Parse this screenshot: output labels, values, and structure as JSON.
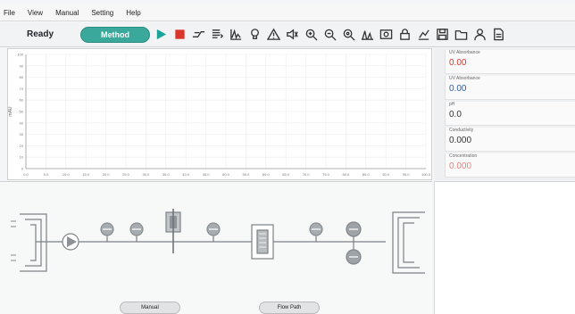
{
  "menu": [
    "File",
    "View",
    "Manual",
    "Setting",
    "Help"
  ],
  "toolbar": {
    "status": "Ready",
    "method_label": "Method",
    "icons": [
      "play-icon",
      "stop-icon",
      "gradient-icon",
      "list-icon",
      "peak-icon",
      "lamp-icon",
      "warning-icon",
      "speaker-icon",
      "zoom-in-icon",
      "zoom-out-icon",
      "zoom-reset-icon",
      "integrate-icon",
      "image-icon",
      "lock-icon",
      "chart-edit-icon",
      "save-icon",
      "folder-icon",
      "user-icon",
      "report-icon"
    ],
    "colors": {
      "play": "#1aa39a",
      "stop": "#d9352c",
      "icon": "#333333"
    }
  },
  "chart_data": {
    "type": "line",
    "xlabel": "",
    "ylabel": "mAU",
    "x_ticks": [
      "0.0",
      "5.0",
      "10.0",
      "15.0",
      "20.0",
      "25.0",
      "30.0",
      "35.0",
      "40.0",
      "45.0",
      "50.0",
      "55.0",
      "60.0",
      "65.0",
      "70.0",
      "75.0",
      "80.0",
      "85.0",
      "90.0",
      "95.0",
      "100.0"
    ],
    "y_ticks": [
      "100",
      "90",
      "80",
      "70",
      "60",
      "50",
      "40",
      "30",
      "20",
      "10",
      "0"
    ],
    "xlim": [
      0,
      100
    ],
    "ylim": [
      0,
      100
    ],
    "series": [],
    "grid": true
  },
  "readouts": [
    {
      "label": "UV Absorbance",
      "value": "0.00",
      "color": "#d9352c"
    },
    {
      "label": "UV Absorbance",
      "value": "0.00",
      "color": "#2a5db0"
    },
    {
      "label": "pH",
      "value": "0.0",
      "color": "#333333"
    },
    {
      "label": "Conductivity",
      "value": "0.000",
      "color": "#333333"
    },
    {
      "label": "Concentration",
      "value": "0.000",
      "color": "#e8837c"
    }
  ],
  "buttons": {
    "manual": "Manual",
    "flow_path": "Flow Path"
  }
}
